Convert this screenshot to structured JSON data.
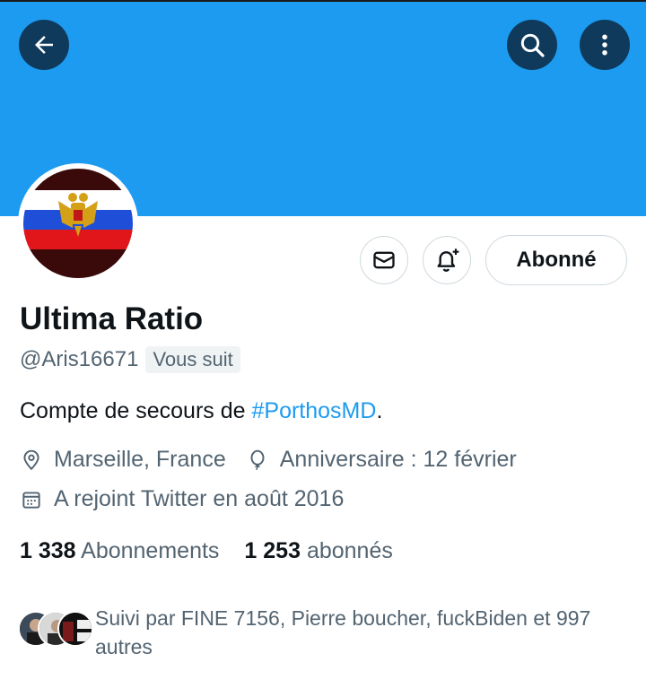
{
  "header": {
    "back_icon": "arrow-left-icon",
    "search_icon": "search-icon",
    "more_icon": "more-vertical-icon",
    "banner_color": "#1d9bf0"
  },
  "profile": {
    "name": "Ultima Ratio",
    "handle": "@Aris16671",
    "follows_you_badge": "Vous suit",
    "bio_prefix": "Compte de secours de ",
    "bio_hashtag": "#PorthosMD",
    "bio_suffix": ".",
    "location": "Marseille, France",
    "birthday": "Anniversaire : 12 février",
    "joined": "A rejoint Twitter en août 2016"
  },
  "actions": {
    "message_icon": "mail-icon",
    "notify_icon": "bell-plus-icon",
    "follow_label": "Abonné"
  },
  "stats": {
    "following_count": "1 338",
    "following_label": "Abonnements",
    "followers_count": "1 253",
    "followers_label": "abonnés"
  },
  "followed_by": {
    "text": "Suivi par FINE 7156, Pierre boucher, fuckBiden et 997 autres"
  },
  "colors": {
    "accent": "#1d9bf0",
    "dark_button": "#0f3a5c",
    "text_primary": "#0f1419",
    "text_secondary": "#536471"
  }
}
